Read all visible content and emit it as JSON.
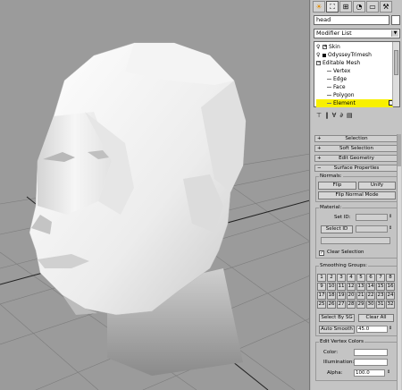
{
  "viewport": {
    "name": "perspective-viewport"
  },
  "tabs": [
    {
      "icon": "create-icon",
      "glyph": "☀"
    },
    {
      "icon": "modify-icon",
      "glyph": "⛶"
    },
    {
      "icon": "hierarchy-icon",
      "glyph": "⊞"
    },
    {
      "icon": "motion-icon",
      "glyph": "◔"
    },
    {
      "icon": "display-icon",
      "glyph": "▭"
    },
    {
      "icon": "utilities-icon",
      "glyph": "⚒"
    }
  ],
  "object_name": "head",
  "modifier_list": "Modifier List",
  "stack": {
    "items": [
      "Skin",
      "OdysseyTrimesh",
      "Editable Mesh"
    ],
    "subobjects": [
      "Vertex",
      "Edge",
      "Face",
      "Polygon",
      "Element"
    ],
    "selected": "Element",
    "colors": {
      "highlight": "#f8f000"
    }
  },
  "rollouts": {
    "selection": "Selection",
    "soft_selection": "Soft Selection",
    "edit_geometry": "Edit Geometry",
    "surface_properties": "Surface Properties"
  },
  "normals": {
    "group": "Normals:",
    "flip": "Flip",
    "unify": "Unify",
    "flip_normal_mode": "Flip Normal Mode"
  },
  "material": {
    "group": "Material:",
    "set_id": "Set ID:",
    "select_id": "Select ID",
    "clear_selection": "Clear Selection",
    "clear_selection_checked": true
  },
  "smoothing": {
    "group": "Smoothing Groups:",
    "numbers": [
      "1",
      "2",
      "3",
      "4",
      "5",
      "6",
      "7",
      "8",
      "9",
      "10",
      "11",
      "12",
      "13",
      "14",
      "15",
      "16",
      "17",
      "18",
      "19",
      "20",
      "21",
      "22",
      "23",
      "24",
      "25",
      "26",
      "27",
      "28",
      "29",
      "30",
      "31",
      "32"
    ],
    "select_by_sg": "Select By SG",
    "clear_all": "Clear All",
    "auto_smooth": "Auto Smooth",
    "auto_smooth_value": "45.0"
  },
  "vertex_colors": {
    "group": "Edit Vertex Colors",
    "color": "Color:",
    "illumination": "Illumination:",
    "alpha": "Alpha:",
    "alpha_value": "100.0"
  }
}
